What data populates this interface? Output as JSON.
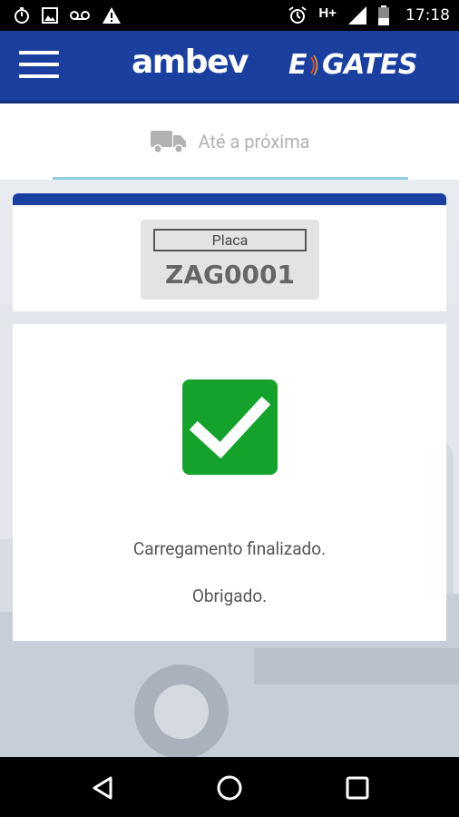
{
  "status_bar": {
    "time": "17:18",
    "network": "H+",
    "icons_left": [
      "stopwatch-icon",
      "image-icon",
      "voicemail-icon",
      "warning-icon"
    ],
    "icons_right": [
      "alarm-icon",
      "network-type-icon",
      "signal-icon",
      "battery-icon"
    ]
  },
  "header": {
    "brand_left": "ambev",
    "brand_right_prefix": "E",
    "brand_right_suffix": "GATES"
  },
  "tab": {
    "label": "Até a próxima",
    "icon": "truck-icon"
  },
  "plate": {
    "label": "Placa",
    "value": "ZAG0001"
  },
  "result": {
    "message": "Carregamento finalizado.",
    "thanks": "Obrigado.",
    "icon": "check-icon",
    "color": "#14a22d"
  },
  "colors": {
    "primary": "#1a3f9f",
    "success": "#14a22d",
    "tab_indicator": "#8ecfe0"
  },
  "navigation": [
    "back-icon",
    "home-icon",
    "recents-icon"
  ]
}
